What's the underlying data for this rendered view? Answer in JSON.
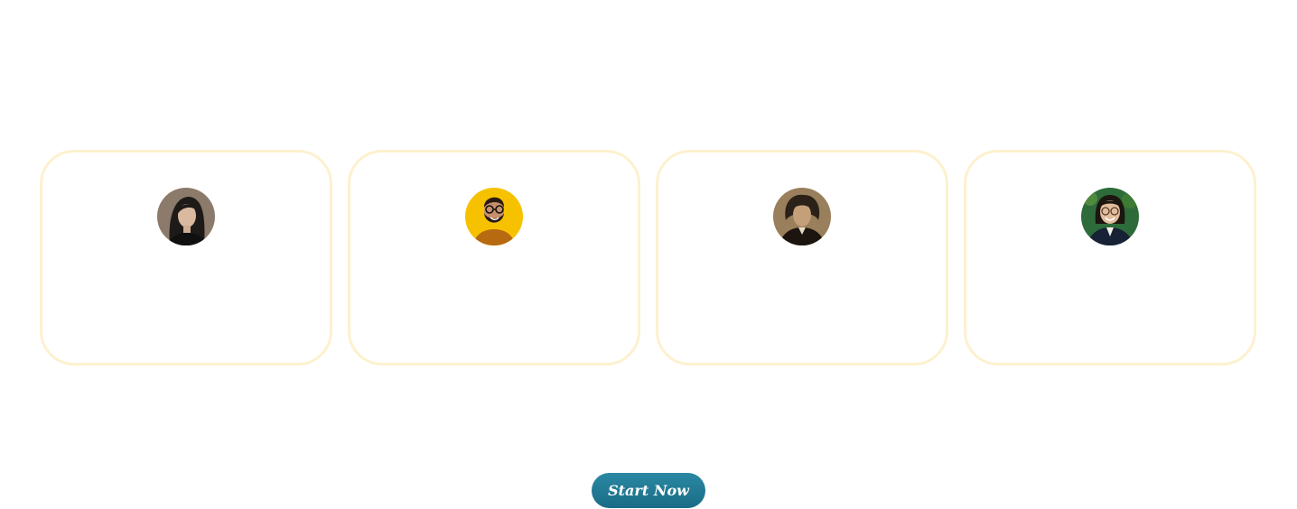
{
  "cards": [
    {
      "avatar": "portrait-woman-dark-hair-avatar",
      "bg": "#8c7a6a"
    },
    {
      "avatar": "portrait-man-glasses-beard-avatar",
      "bg": "#f6c200"
    },
    {
      "avatar": "portrait-victorian-man-avatar",
      "bg": "#9a7f5c"
    },
    {
      "avatar": "portrait-woman-glasses-avatar",
      "bg": "#2e6b3a"
    }
  ],
  "cta": {
    "label": "Start Now",
    "color": "#1e7891"
  },
  "colors": {
    "card_border": "#fdf1cf"
  }
}
